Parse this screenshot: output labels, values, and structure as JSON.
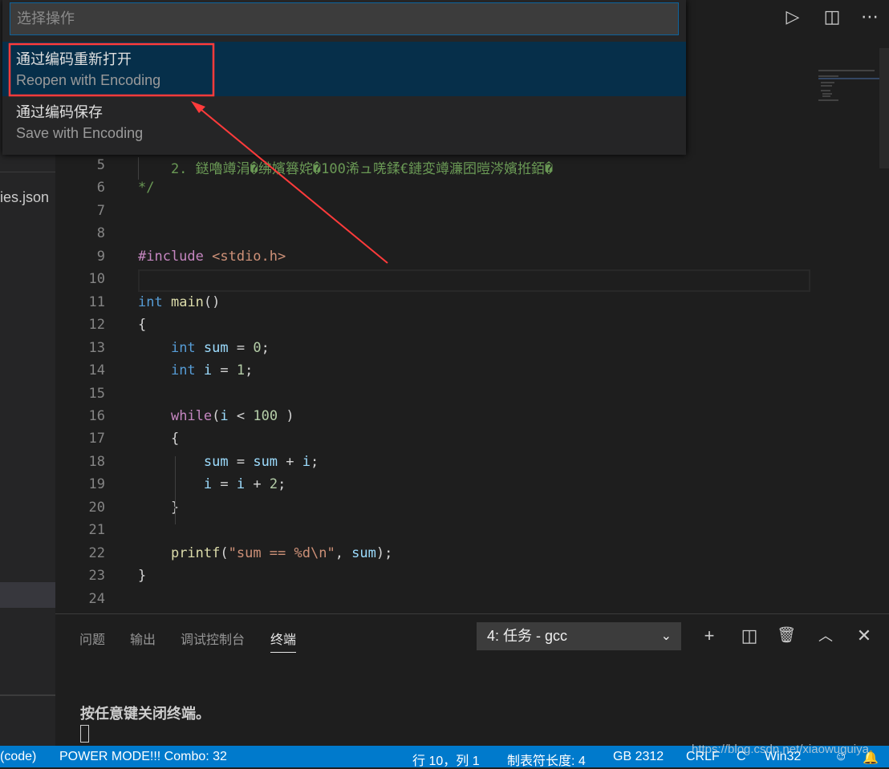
{
  "sidebar": {
    "file_label": "ies.json"
  },
  "top_icons": [
    "run-icon",
    "split-editor-icon",
    "more-icon"
  ],
  "quick_pick": {
    "placeholder": "选择操作",
    "items": [
      {
        "title": "通过编码重新打开",
        "detail": "Reopen with Encoding",
        "active": true
      },
      {
        "title": "通过编码保存",
        "detail": "Save with Encoding",
        "active": false
      }
    ]
  },
  "editor": {
    "first_line": 5,
    "current_line": 10,
    "lines": [
      [
        [
          "    2. 鎹嚕竴涓�绋嬪簭姹�100浠ュ唴鍒€鏈変竴濂囨暟涔嬪拰銆�",
          "cm"
        ]
      ],
      [
        [
          "*/",
          "cm"
        ]
      ],
      [],
      [],
      [
        [
          "#include ",
          "kw"
        ],
        [
          "<stdio.h>",
          "st"
        ]
      ],
      [],
      [
        [
          "int",
          "ty"
        ],
        [
          " ",
          "pl"
        ],
        [
          "main",
          "fn"
        ],
        [
          "()",
          "pl"
        ]
      ],
      [
        [
          "{",
          "pl"
        ]
      ],
      [
        [
          "    ",
          "pl"
        ],
        [
          "int",
          "ty"
        ],
        [
          " ",
          "pl"
        ],
        [
          "sum",
          "va"
        ],
        [
          " = ",
          "pl"
        ],
        [
          "0",
          "nu"
        ],
        [
          ";",
          "pl"
        ]
      ],
      [
        [
          "    ",
          "pl"
        ],
        [
          "int",
          "ty"
        ],
        [
          " ",
          "pl"
        ],
        [
          "i",
          "va"
        ],
        [
          " = ",
          "pl"
        ],
        [
          "1",
          "nu"
        ],
        [
          ";",
          "pl"
        ]
      ],
      [],
      [
        [
          "    ",
          "pl"
        ],
        [
          "while",
          "kw"
        ],
        [
          "(",
          "pl"
        ],
        [
          "i",
          "va"
        ],
        [
          " < ",
          "pl"
        ],
        [
          "100",
          "nu"
        ],
        [
          " )",
          "pl"
        ]
      ],
      [
        [
          "    {",
          "pl"
        ]
      ],
      [
        [
          "        ",
          "pl"
        ],
        [
          "sum",
          "va"
        ],
        [
          " = ",
          "pl"
        ],
        [
          "sum",
          "va"
        ],
        [
          " + ",
          "pl"
        ],
        [
          "i",
          "va"
        ],
        [
          ";",
          "pl"
        ]
      ],
      [
        [
          "        ",
          "pl"
        ],
        [
          "i",
          "va"
        ],
        [
          " = ",
          "pl"
        ],
        [
          "i",
          "va"
        ],
        [
          " + ",
          "pl"
        ],
        [
          "2",
          "nu"
        ],
        [
          ";",
          "pl"
        ]
      ],
      [
        [
          "    }",
          "pl"
        ]
      ],
      [],
      [
        [
          "    ",
          "pl"
        ],
        [
          "printf",
          "fn"
        ],
        [
          "(",
          "pl"
        ],
        [
          "\"sum == %d\\n\"",
          "st"
        ],
        [
          ", ",
          "pl"
        ],
        [
          "sum",
          "va"
        ],
        [
          ");",
          "pl"
        ]
      ],
      [
        [
          "}",
          "pl"
        ]
      ],
      []
    ]
  },
  "panel": {
    "tabs": [
      {
        "label": "问题"
      },
      {
        "label": "输出"
      },
      {
        "label": "调试控制台"
      },
      {
        "label": "终端",
        "active": true
      }
    ],
    "terminal_select": "4: 任务 - gcc",
    "icons": [
      "plus-icon",
      "split-terminal-icon",
      "trash-icon",
      "chevron-up-icon",
      "close-icon"
    ],
    "terminal_text": "按任意键关闭终端。"
  },
  "status": {
    "left": [
      "(code)",
      "POWER MODE!!! Combo: 32"
    ],
    "position": "行 10，列 1",
    "tab_size": "制表符长度: 4",
    "encoding": "GB 2312",
    "eol": "CRLF",
    "language": "C",
    "platform": "Win32",
    "icons": [
      "feedback-icon",
      "bell-icon"
    ]
  },
  "watermark": "https://blog.csdn.net/xiaowuguiya",
  "colors": {
    "status_bar": "#007acc",
    "selection": "#062f4a",
    "annotation": "#ff3b3b"
  }
}
